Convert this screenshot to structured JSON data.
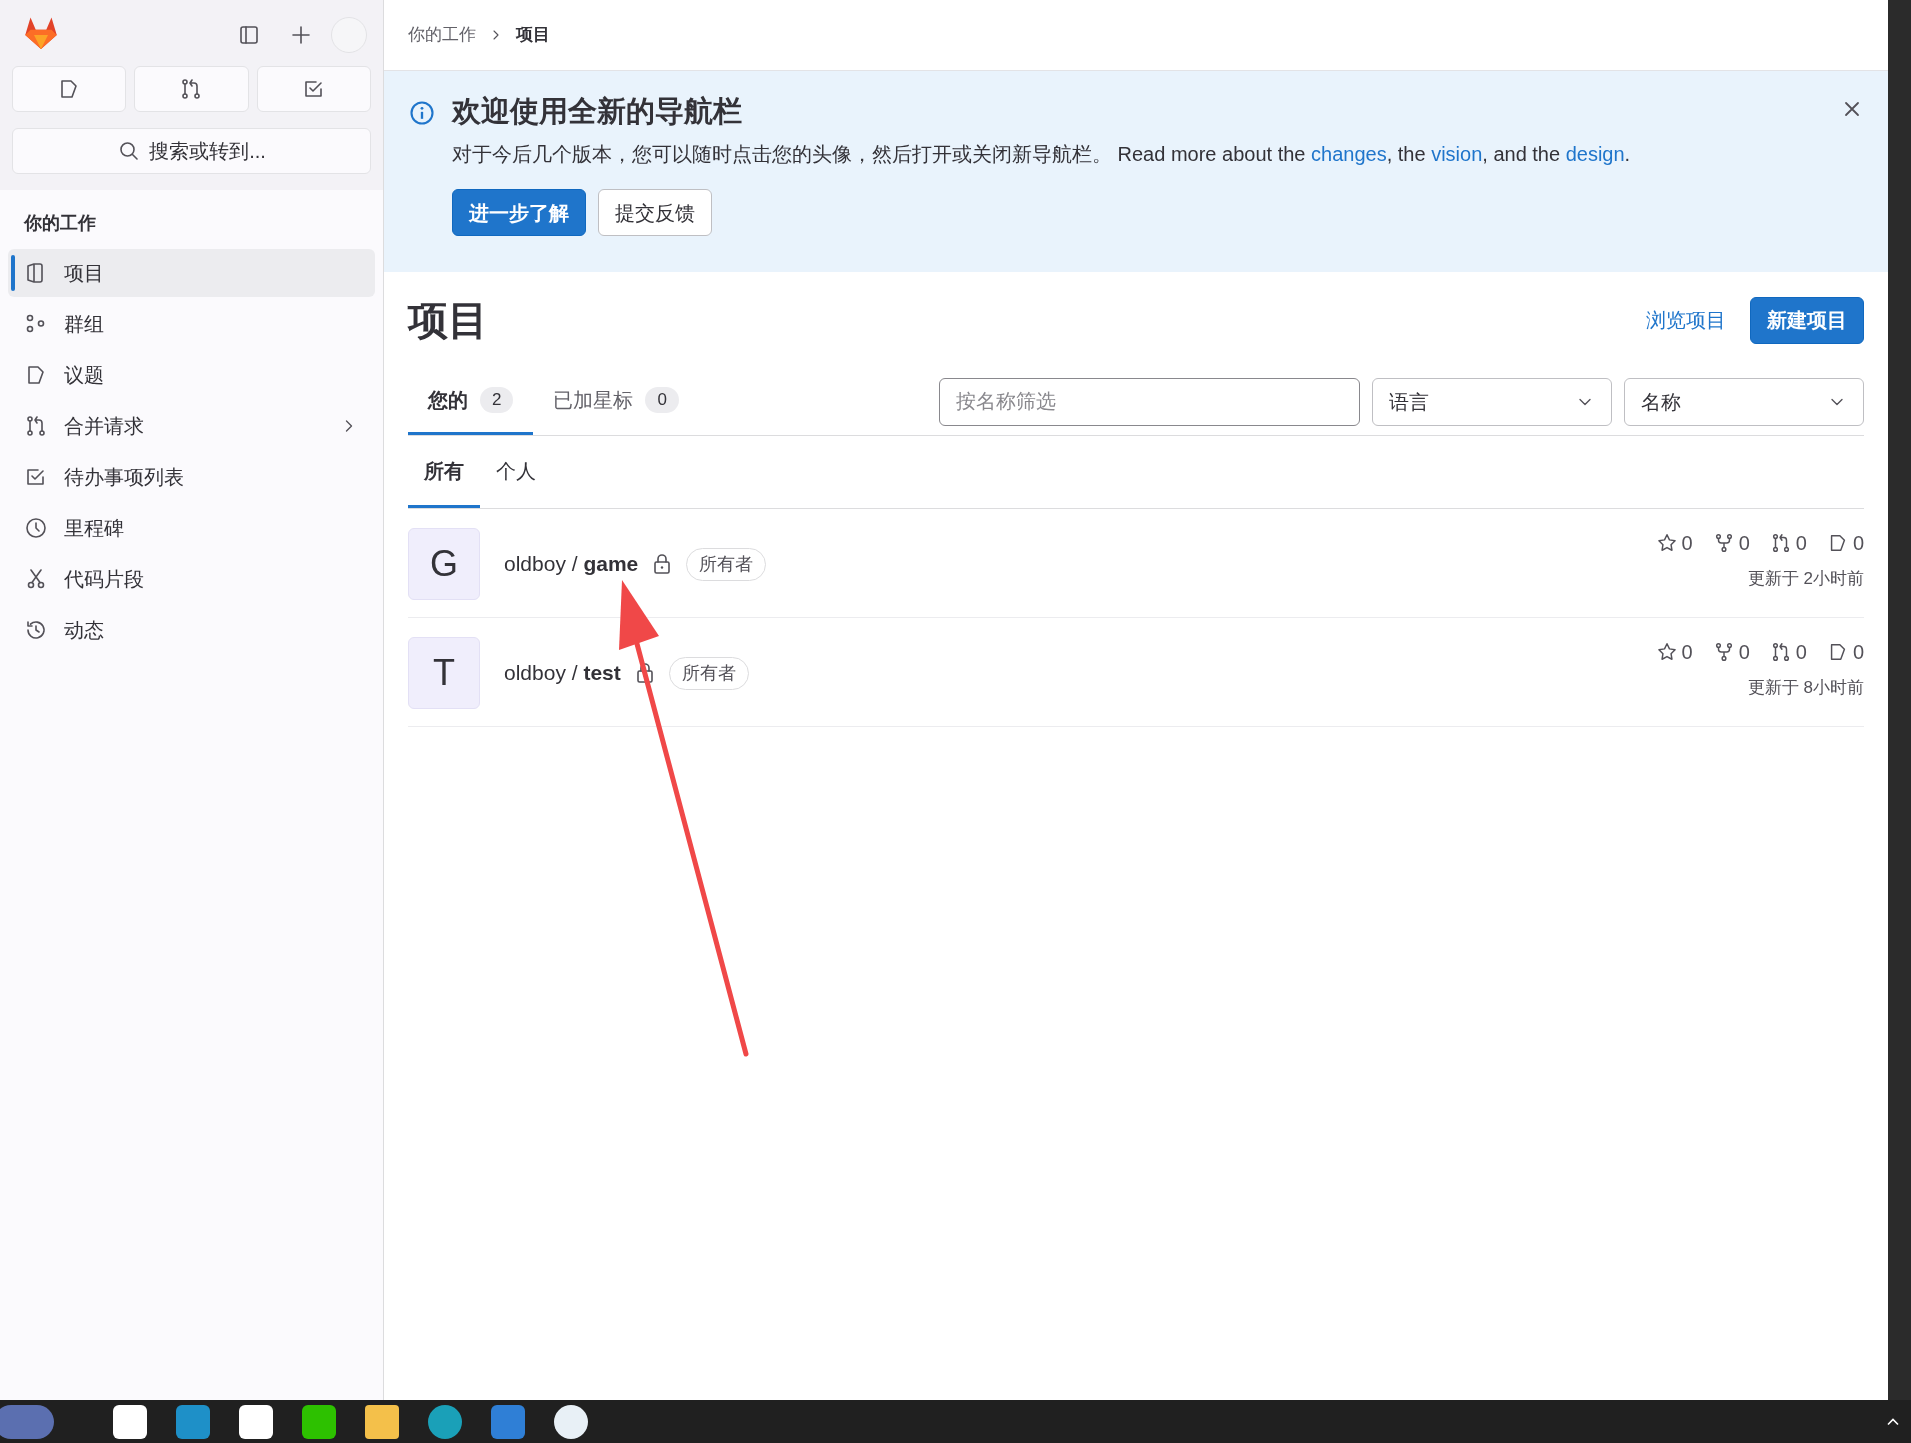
{
  "sidebar": {
    "search": {
      "placeholder": "搜索或转到..."
    },
    "section_title": "你的工作",
    "items": [
      {
        "label": "项目",
        "selected": true,
        "expandable": false
      },
      {
        "label": "群组",
        "selected": false,
        "expandable": false
      },
      {
        "label": "议题",
        "selected": false,
        "expandable": false
      },
      {
        "label": "合并请求",
        "selected": false,
        "expandable": true
      },
      {
        "label": "待办事项列表",
        "selected": false,
        "expandable": false
      },
      {
        "label": "里程碑",
        "selected": false,
        "expandable": false
      },
      {
        "label": "代码片段",
        "selected": false,
        "expandable": false
      },
      {
        "label": "动态",
        "selected": false,
        "expandable": false
      }
    ]
  },
  "breadcrumb": [
    {
      "label": "你的工作",
      "current": false
    },
    {
      "label": "项目",
      "current": true
    }
  ],
  "banner": {
    "title": "欢迎使用全新的导航栏",
    "body": [
      {
        "kind": "text",
        "text": "对于今后几个版本，您可以随时点击您的头像，然后打开或关闭新导航栏。 Read more about the "
      },
      {
        "kind": "link",
        "text": "changes"
      },
      {
        "kind": "text",
        "text": ", the "
      },
      {
        "kind": "link",
        "text": "vision"
      },
      {
        "kind": "text",
        "text": ", and the "
      },
      {
        "kind": "link",
        "text": "design"
      },
      {
        "kind": "text",
        "text": "."
      }
    ],
    "buttons": [
      {
        "label": "进一步了解",
        "kind": "primary"
      },
      {
        "label": "提交反馈",
        "kind": "secondary"
      }
    ]
  },
  "page": {
    "title": "项目",
    "browse_link": "浏览项目",
    "new_button": "新建项目"
  },
  "tabs": [
    {
      "label": "您的",
      "count": "2",
      "selected": true
    },
    {
      "label": "已加星标",
      "count": "0",
      "selected": false
    }
  ],
  "filter": {
    "placeholder": "按名称筛选"
  },
  "dropdowns": [
    "语言",
    "名称"
  ],
  "subtabs": [
    {
      "label": "所有",
      "selected": true
    },
    {
      "label": "个人",
      "selected": false
    }
  ],
  "projects": [
    {
      "avatar": "G",
      "name": "oldboy / **game**",
      "private": true,
      "role": "所有者",
      "stars": "0",
      "forks": "0",
      "merge_requests": "0",
      "issues": "0",
      "updated": "更新于 2小时前"
    },
    {
      "avatar": "T",
      "name": "oldboy / **test**",
      "private": true,
      "role": "所有者",
      "stars": "0",
      "forks": "0",
      "merge_requests": "0",
      "issues": "0",
      "updated": "更新于 8小时前"
    }
  ]
}
